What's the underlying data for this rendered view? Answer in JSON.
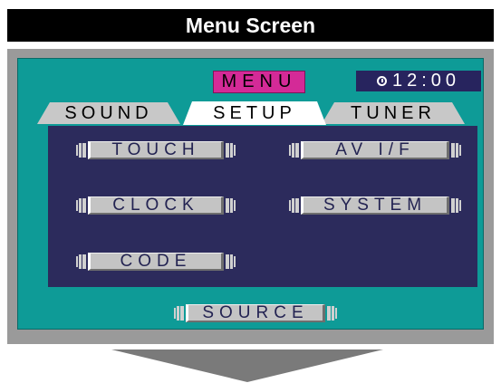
{
  "header": {
    "title": "Menu Screen"
  },
  "screen": {
    "menu_label": "MENU",
    "clock": {
      "icon": "clock-icon",
      "time": "12:00"
    },
    "tabs": [
      {
        "label": "SOUND",
        "active": false
      },
      {
        "label": "SETUP",
        "active": true
      },
      {
        "label": "TUNER",
        "active": false
      }
    ],
    "buttons": {
      "touch": "TOUCH",
      "av_if": "AV I/F",
      "clock": "CLOCK",
      "system": "SYSTEM",
      "code": "CODE",
      "source": "SOURCE"
    }
  },
  "colors": {
    "screen_bg": "#0e9b97",
    "panel_bg": "#2c2b5c",
    "menu_label_bg": "#d42a97",
    "clock_bg": "#27245e",
    "button_face": "#c4c4c4",
    "frame": "#9a9a9a"
  },
  "icons": {
    "down_arrow": "down-arrow-icon"
  }
}
